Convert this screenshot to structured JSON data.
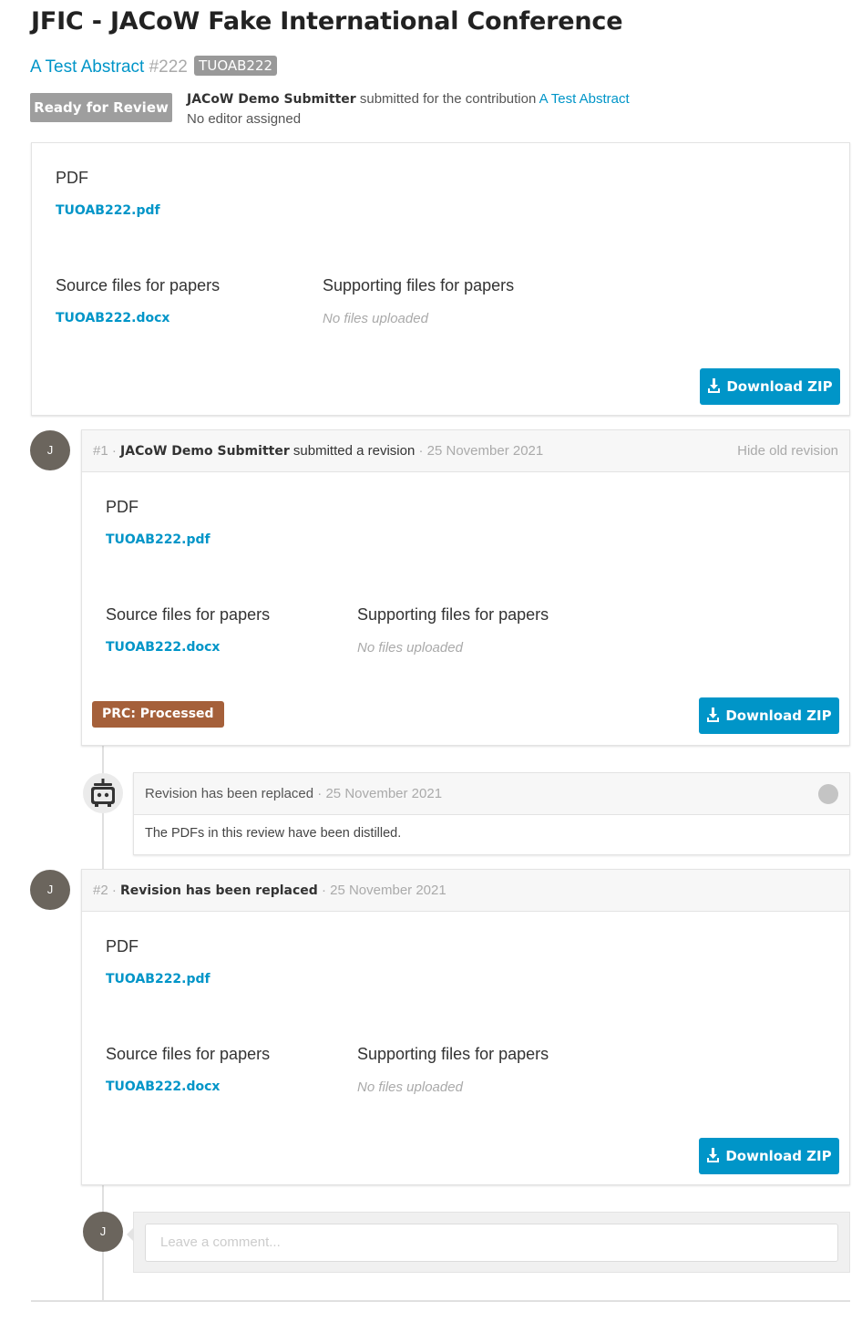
{
  "page": {
    "title": "JFIC - JACoW Fake International Conference"
  },
  "contribution": {
    "title": "A Test Abstract",
    "number": "#222",
    "code": "TUOAB222"
  },
  "status": {
    "badge": "Ready for Review",
    "submitter": "JACoW Demo Submitter",
    "submitted_text": "submitted for the contribution",
    "contribution_link": "A Test Abstract",
    "editor": "No editor assigned"
  },
  "labels": {
    "pdf": "PDF",
    "source": "Source files for papers",
    "supporting": "Supporting files for papers",
    "no_files": "No files uploaded",
    "download_zip": "Download ZIP"
  },
  "current_files": {
    "pdf": "TUOAB222.pdf",
    "source": "TUOAB222.docx"
  },
  "revision1": {
    "avatar": "J",
    "number": "#1",
    "sep": "·",
    "author": "JACoW Demo Submitter",
    "action": "submitted a revision",
    "date": "25 November 2021",
    "hide_link": "Hide old revision",
    "pdf": "TUOAB222.pdf",
    "source": "TUOAB222.docx",
    "tag": "PRC: Processed"
  },
  "system_comment": {
    "title": "Revision has been replaced",
    "date": "25 November 2021",
    "body": "The PDFs in this review have been distilled."
  },
  "revision2": {
    "avatar": "J",
    "number": "#2",
    "title": "Revision has been replaced",
    "date": "25 November 2021",
    "pdf": "TUOAB222.pdf",
    "source": "TUOAB222.docx"
  },
  "comment_form": {
    "avatar": "J",
    "placeholder": "Leave a comment..."
  },
  "colors": {
    "link": "#0095c8",
    "status_badge": "#9e9e9e",
    "prc_tag": "#a5603a",
    "avatar": "#6b655d"
  }
}
